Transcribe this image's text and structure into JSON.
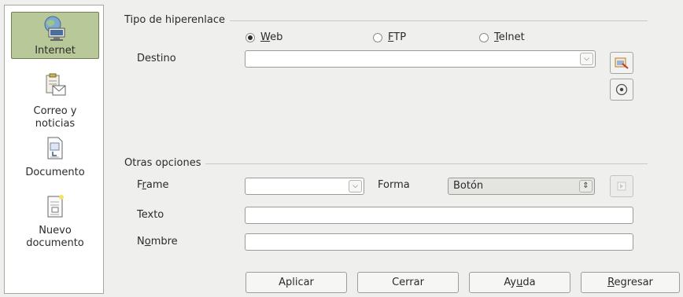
{
  "sidebar": {
    "items": [
      {
        "label": "Internet",
        "icon": "internet-icon",
        "selected": true
      },
      {
        "label": "Correo y\nnoticias",
        "icon": "mail-news-icon",
        "selected": false
      },
      {
        "label": "Documento",
        "icon": "document-icon",
        "selected": false
      },
      {
        "label": "Nuevo\ndocumento",
        "icon": "new-document-icon",
        "selected": false
      }
    ]
  },
  "hyperlink_type": {
    "title": "Tipo de hiperenlace",
    "options": [
      {
        "prefix": "",
        "accel": "W",
        "rest": "eb",
        "checked": true
      },
      {
        "prefix": "",
        "accel": "F",
        "rest": "TP",
        "checked": false
      },
      {
        "prefix": "",
        "accel": "T",
        "rest": "elnet",
        "checked": false
      }
    ],
    "destino_label": "Destino",
    "destino_value": ""
  },
  "other_options": {
    "title": "Otras opciones",
    "frame_label": {
      "prefix": "F",
      "accel": "r",
      "rest": "ame"
    },
    "frame_value": "",
    "forma_label": "Forma",
    "forma_value": "Botón",
    "texto_label": "Texto",
    "texto_value": "",
    "nombre_label": {
      "prefix": "N",
      "accel": "o",
      "rest": "mbre"
    },
    "nombre_value": ""
  },
  "buttons": {
    "apply": {
      "prefix": "Aplicar",
      "accel": "",
      "rest": ""
    },
    "close": {
      "prefix": "Cerrar",
      "accel": "",
      "rest": ""
    },
    "help": {
      "prefix": "Ay",
      "accel": "u",
      "rest": "da"
    },
    "back": {
      "prefix": "",
      "accel": "R",
      "rest": "egresar"
    }
  },
  "colors": {
    "selection": "#b9c898",
    "background": "#efefed"
  }
}
